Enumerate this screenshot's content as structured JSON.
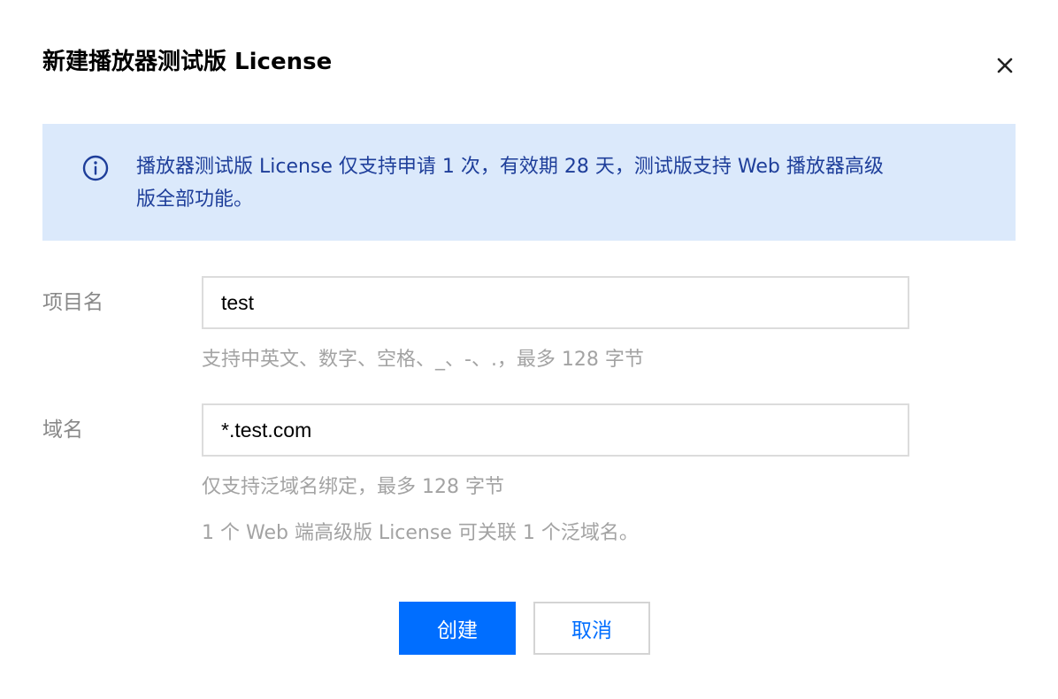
{
  "dialog": {
    "title": "新建播放器测试版 License",
    "close_icon": "close-icon"
  },
  "notice": {
    "icon": "info-icon",
    "text_line1": "播放器测试版 License 仅支持申请 1 次，有效期 28 天，测试版支持 Web 播放器高级",
    "text_line2": "版全部功能。",
    "background_color": "#dbe9fb",
    "text_color": "#1e3e9a"
  },
  "form": {
    "project": {
      "label": "项目名",
      "value": "test",
      "help": "支持中英文、数字、空格、_、-、.，最多 128 字节"
    },
    "domain": {
      "label": "域名",
      "value": "*.test.com",
      "help1": "仅支持泛域名绑定，最多 128 字节",
      "help2": "1 个 Web 端高级版 License 可关联 1 个泛域名。"
    }
  },
  "actions": {
    "create_label": "创建",
    "cancel_label": "取消",
    "primary_color": "#006eff"
  }
}
